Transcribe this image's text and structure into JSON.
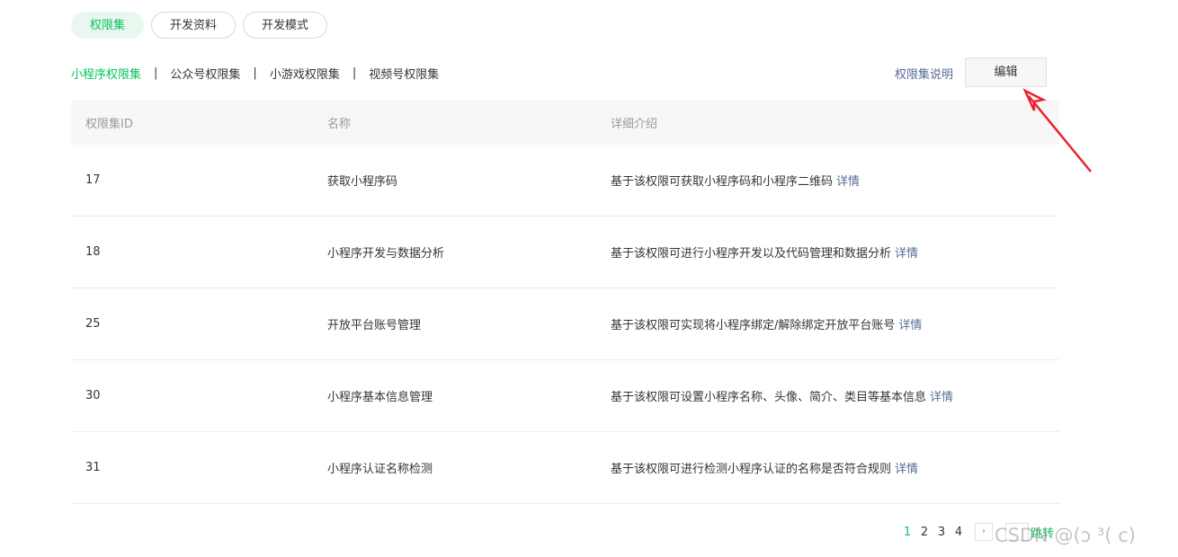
{
  "top_tabs": [
    {
      "label": "权限集",
      "active": true
    },
    {
      "label": "开发资料",
      "active": false
    },
    {
      "label": "开发模式",
      "active": false
    }
  ],
  "sub_nav": {
    "items": [
      "小程序权限集",
      "公众号权限集",
      "小游戏权限集",
      "视频号权限集"
    ],
    "separator": "|",
    "active_index": 0
  },
  "explain_link": "权限集说明",
  "edit_button": "编辑",
  "table": {
    "headers": [
      "权限集ID",
      "名称",
      "详细介绍"
    ],
    "detail_link_label": "详情",
    "rows": [
      {
        "id": "17",
        "name": "获取小程序码",
        "desc": "基于该权限可获取小程序码和小程序二维码"
      },
      {
        "id": "18",
        "name": "小程序开发与数据分析",
        "desc": "基于该权限可进行小程序开发以及代码管理和数据分析"
      },
      {
        "id": "25",
        "name": "开放平台账号管理",
        "desc": "基于该权限可实现将小程序绑定/解除绑定开放平台账号"
      },
      {
        "id": "30",
        "name": "小程序基本信息管理",
        "desc": "基于该权限可设置小程序名称、头像、简介、类目等基本信息"
      },
      {
        "id": "31",
        "name": "小程序认证名称检测",
        "desc": "基于该权限可进行检测小程序认证的名称是否符合规则"
      }
    ]
  },
  "pagination": {
    "pages": [
      "1",
      "2",
      "3",
      "4"
    ],
    "current": "1",
    "next_symbol": "›",
    "jump_label": "跳转"
  },
  "watermark": "CSDN @(ↄ ³(    c)",
  "colors": {
    "accent_green": "#07c160",
    "link_blue": "#576b95",
    "annotation_red": "#e8232a"
  }
}
